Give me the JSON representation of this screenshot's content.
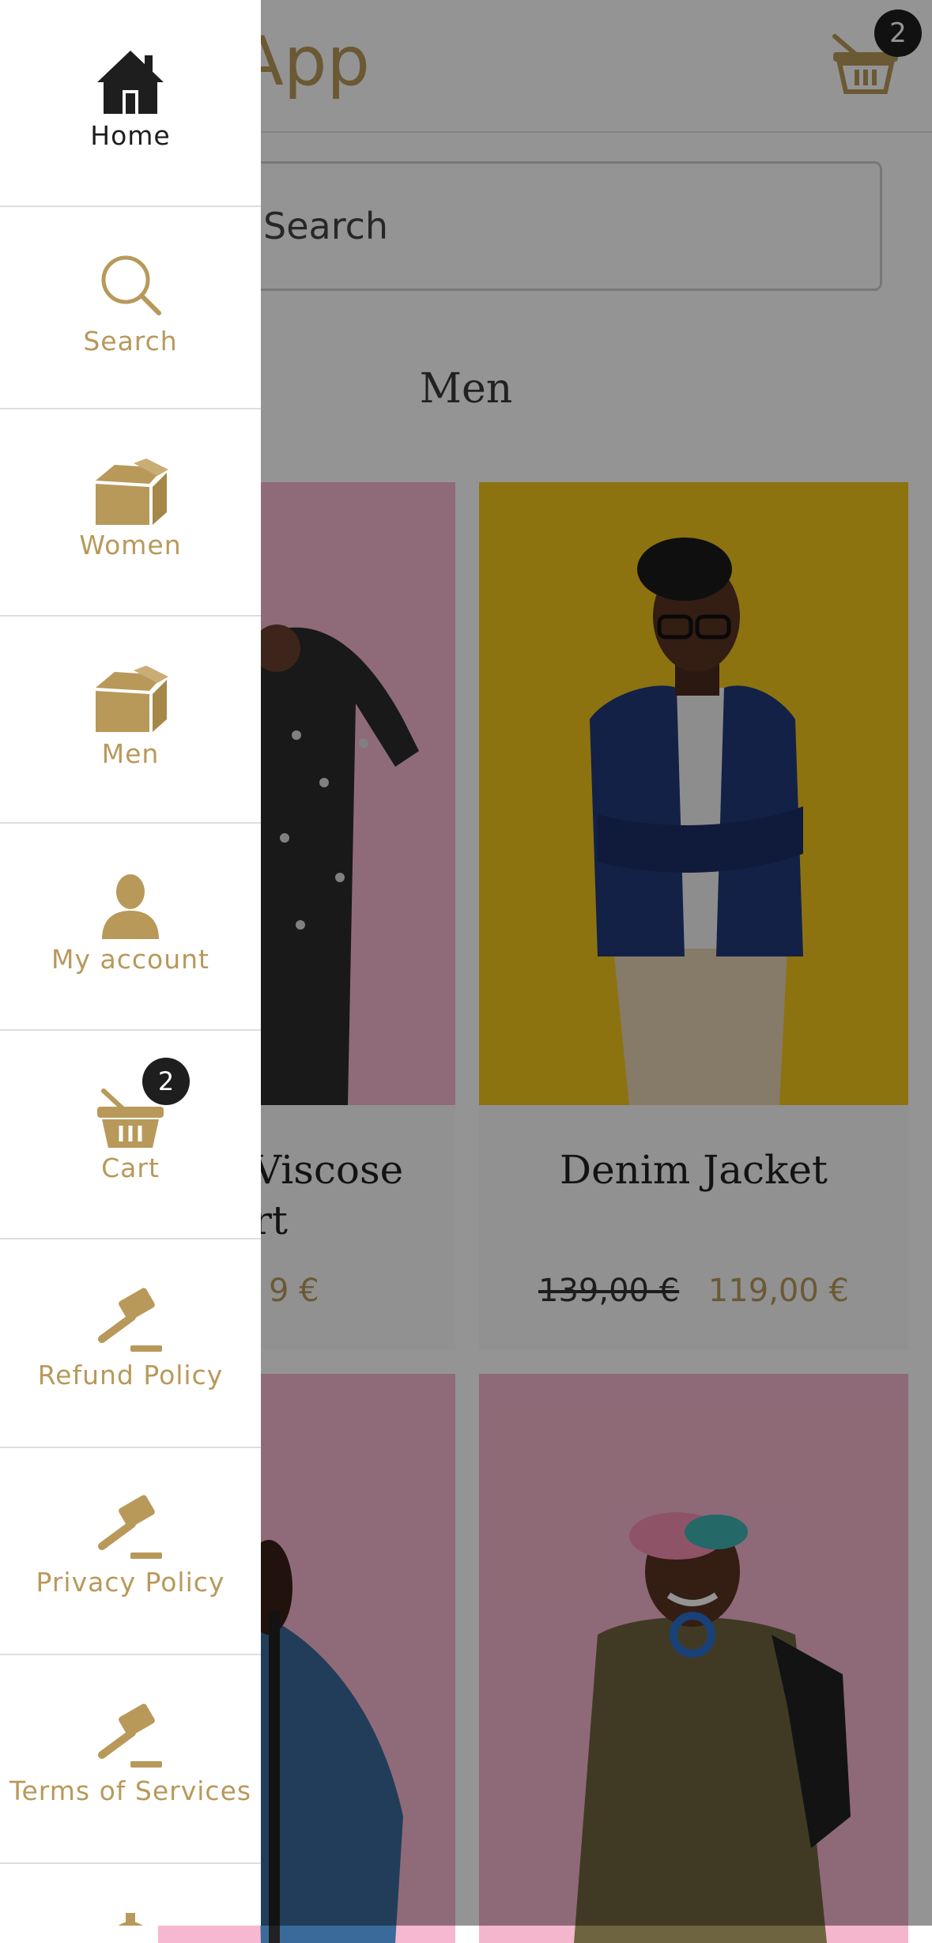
{
  "app": {
    "title": "App"
  },
  "header": {
    "cart_count": "2"
  },
  "search": {
    "placeholder": "Search"
  },
  "section": {
    "title": "Men"
  },
  "products": [
    {
      "name": "Viscose",
      "name_line2": "rt",
      "price_current": "9 €"
    },
    {
      "name": "Denim Jacket",
      "price_old": "139,00 €",
      "price_current": "119,00 €"
    }
  ],
  "drawer": {
    "items": [
      {
        "label": "Home",
        "icon": "home-icon",
        "active": true
      },
      {
        "label": "Search",
        "icon": "search-icon"
      },
      {
        "label": "Women",
        "icon": "box-icon"
      },
      {
        "label": "Men",
        "icon": "box-icon"
      },
      {
        "label": "My account",
        "icon": "user-icon"
      },
      {
        "label": "Cart",
        "icon": "basket-icon",
        "badge": "2"
      },
      {
        "label": "Refund Policy",
        "icon": "gavel-icon"
      },
      {
        "label": "Privacy Policy",
        "icon": "gavel-icon"
      },
      {
        "label": "Terms of Services",
        "icon": "gavel-icon"
      },
      {
        "label": "",
        "icon": "gear-icon"
      }
    ]
  },
  "colors": {
    "accent": "#b8995a",
    "dark": "#1e1e1e",
    "overlay": "rgba(0,0,0,0.42)"
  }
}
